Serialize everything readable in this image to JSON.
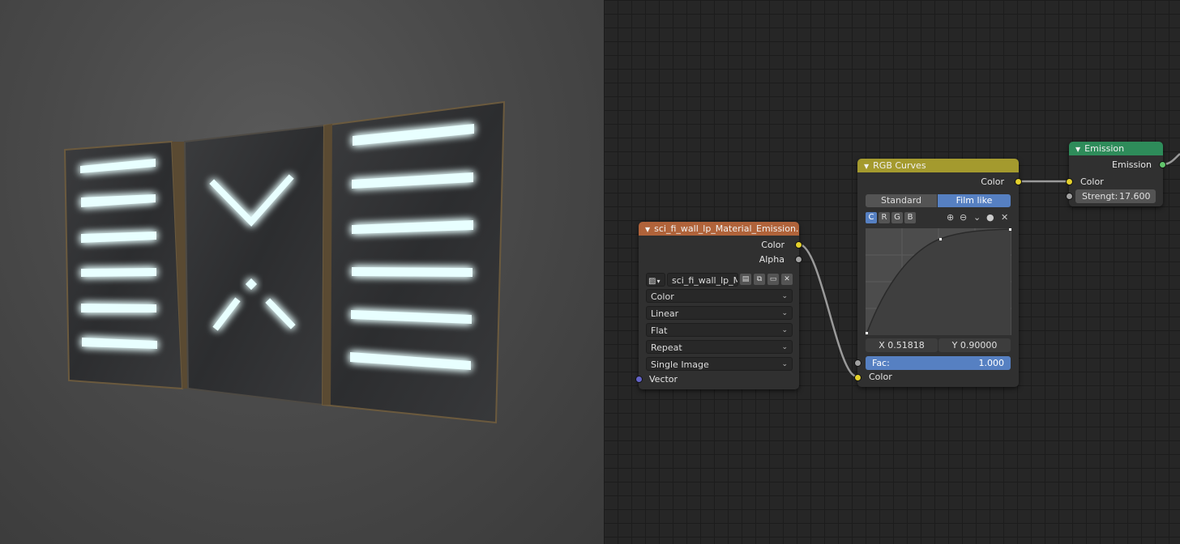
{
  "image_node": {
    "title": "sci_fi_wall_lp_Material_Emission.png",
    "header_color": "#b0633a",
    "outputs": [
      "Color",
      "Alpha"
    ],
    "image_name": "sci_fi_wall_lp_Ma...",
    "dropdowns": [
      "Color",
      "Linear",
      "Flat",
      "Repeat",
      "Single Image"
    ],
    "input": "Vector"
  },
  "curves_node": {
    "title": "RGB Curves",
    "header_color": "#a49a2e",
    "output": "Color",
    "modes": [
      "Standard",
      "Film like"
    ],
    "active_mode": "Film like",
    "channels": [
      "C",
      "R",
      "G",
      "B"
    ],
    "active_channel": "C",
    "x_readout": "X 0.51818",
    "y_readout": "Y 0.90000",
    "fac_label": "Fac:",
    "fac_value": "1.000",
    "input": "Color"
  },
  "emission_node": {
    "title": "Emission",
    "header_color": "#2e8c5a",
    "output": "Emission",
    "input": "Color",
    "strength_label": "Strengt:",
    "strength_value": "17.600"
  },
  "colors": {
    "glow": "#7ff3ff",
    "active_blue": "#5680c2"
  }
}
